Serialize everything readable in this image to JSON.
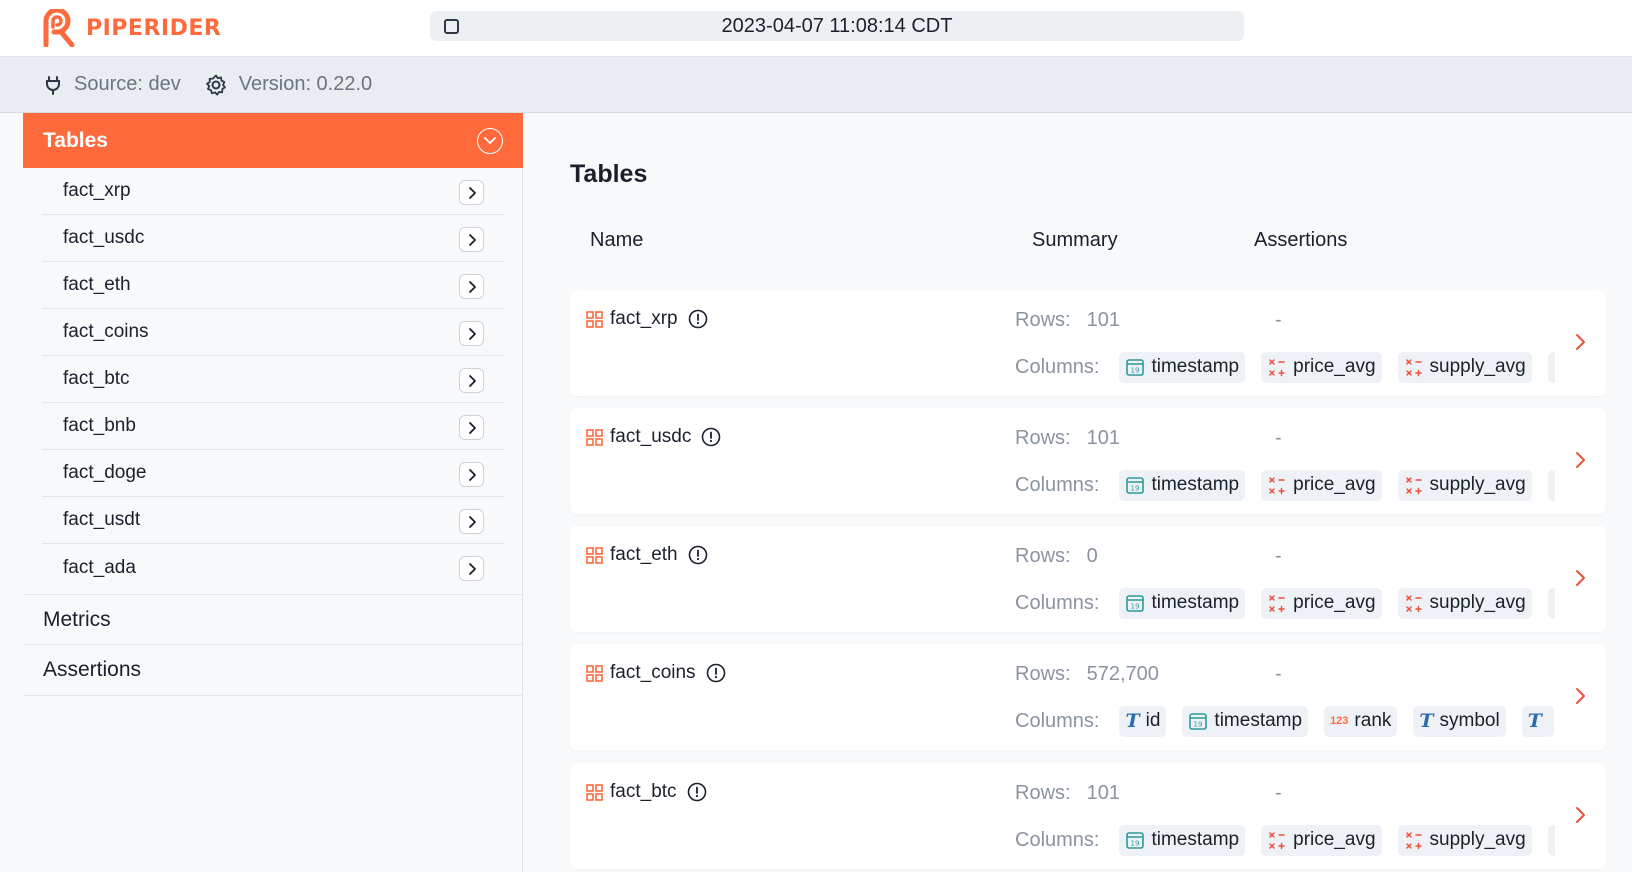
{
  "app": {
    "brand": "PIPERIDER",
    "datetime": "2023-04-07 11:08:14 CDT"
  },
  "info": {
    "source": "Source: dev",
    "version": "Version: 0.22.0"
  },
  "sidebar": {
    "header": "Tables",
    "items": [
      {
        "label": "fact_xrp"
      },
      {
        "label": "fact_usdc"
      },
      {
        "label": "fact_eth"
      },
      {
        "label": "fact_coins"
      },
      {
        "label": "fact_btc"
      },
      {
        "label": "fact_bnb"
      },
      {
        "label": "fact_doge"
      },
      {
        "label": "fact_usdt"
      },
      {
        "label": "fact_ada"
      }
    ],
    "metrics": "Metrics",
    "assertions": "Assertions"
  },
  "main": {
    "title": "Tables",
    "headers": {
      "name": "Name",
      "summary": "Summary",
      "assertions": "Assertions"
    },
    "rows_label": "Rows:",
    "columns_label": "Columns:",
    "tables": [
      {
        "name": "fact_xrp",
        "rows": "101",
        "assertions": "-",
        "columns": [
          {
            "icon": "calendar-icon",
            "name": "timestamp"
          },
          {
            "icon": "numeric-ops-icon",
            "name": "price_avg"
          },
          {
            "icon": "numeric-ops-icon",
            "name": "supply_avg"
          },
          {
            "icon": "numeric-ops-icon",
            "name": ""
          }
        ]
      },
      {
        "name": "fact_usdc",
        "rows": "101",
        "assertions": "-",
        "columns": [
          {
            "icon": "calendar-icon",
            "name": "timestamp"
          },
          {
            "icon": "numeric-ops-icon",
            "name": "price_avg"
          },
          {
            "icon": "numeric-ops-icon",
            "name": "supply_avg"
          },
          {
            "icon": "numeric-ops-icon",
            "name": ""
          }
        ]
      },
      {
        "name": "fact_eth",
        "rows": "0",
        "assertions": "-",
        "columns": [
          {
            "icon": "calendar-icon",
            "name": "timestamp"
          },
          {
            "icon": "numeric-ops-icon",
            "name": "price_avg"
          },
          {
            "icon": "numeric-ops-icon",
            "name": "supply_avg"
          },
          {
            "icon": "numeric-ops-icon",
            "name": ""
          }
        ]
      },
      {
        "name": "fact_coins",
        "rows": "572,700",
        "assertions": "-",
        "columns": [
          {
            "icon": "text-icon",
            "name": "id"
          },
          {
            "icon": "calendar-icon",
            "name": "timestamp"
          },
          {
            "icon": "integer-icon",
            "name": "rank"
          },
          {
            "icon": "text-icon",
            "name": "symbol"
          },
          {
            "icon": "text-icon",
            "name": ""
          }
        ]
      },
      {
        "name": "fact_btc",
        "rows": "101",
        "assertions": "-",
        "columns": [
          {
            "icon": "calendar-icon",
            "name": "timestamp"
          },
          {
            "icon": "numeric-ops-icon",
            "name": "price_avg"
          },
          {
            "icon": "numeric-ops-icon",
            "name": "supply_avg"
          },
          {
            "icon": "numeric-ops-icon",
            "name": ""
          }
        ]
      }
    ]
  },
  "colors": {
    "accent": "#ff6a3d",
    "text": "#1a202c",
    "muted": "#8a94a0",
    "teal": "#2c9a9a",
    "blue": "#2b6cb0"
  }
}
